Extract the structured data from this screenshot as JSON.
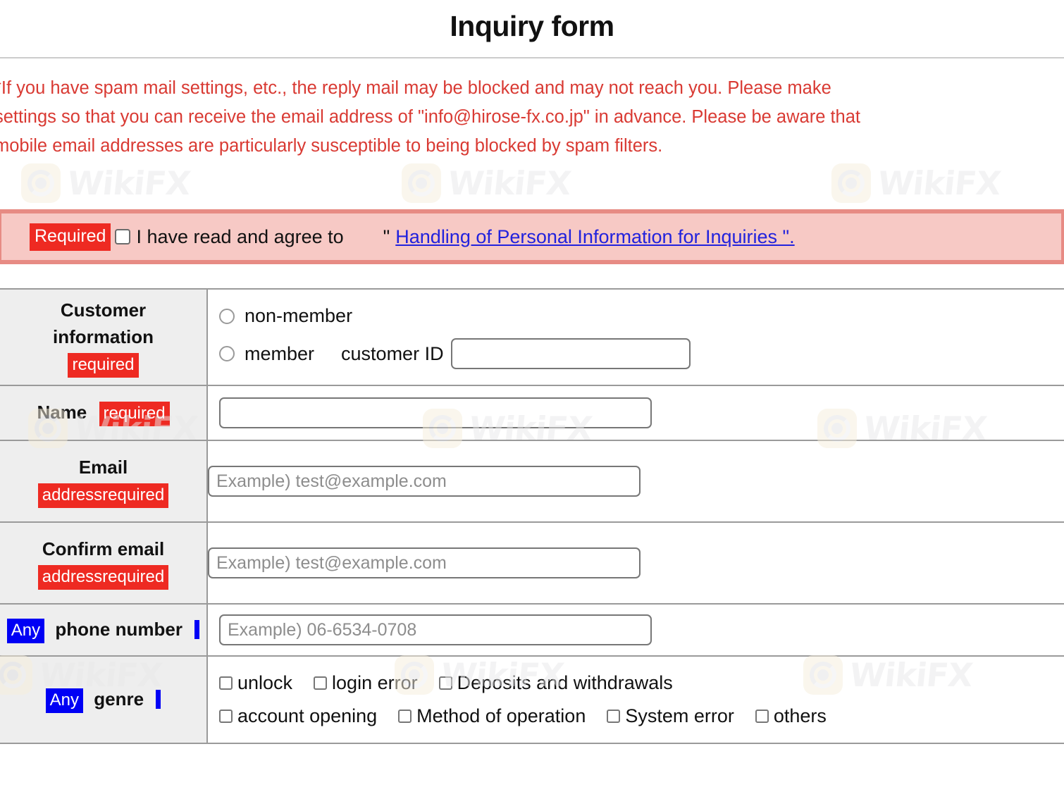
{
  "header": {
    "title": "Inquiry form"
  },
  "notice": {
    "lines": [
      "*If you have spam mail settings, etc., the reply mail may be blocked and may not reach you. Please make",
      "settings so that you can receive the email address of \"info@hirose-fx.co.jp\" in advance. Please be aware that",
      "mobile email addresses are particularly susceptible to being blocked by spam filters."
    ],
    "color": "#d93a33"
  },
  "agreement": {
    "badge": "Required",
    "text": "I have read and agree to",
    "quote_open": "\"",
    "link_text": "Handling of Personal Information for Inquiries \".",
    "checked": false,
    "badge_color": "#ee2a22",
    "box_bg": "#f7c9c5",
    "box_border": "#e78b84",
    "link_color": "#2222dd"
  },
  "form": {
    "rows": [
      {
        "label_line1": "Customer",
        "label_line2": "information",
        "badge": "required",
        "badge_kind": "required"
      },
      {
        "label_line1": "Name",
        "badge": "required",
        "badge_kind": "required"
      },
      {
        "label_line1": "Email",
        "badge": "addressrequired",
        "badge_kind": "required"
      },
      {
        "label_line1": "Confirm email",
        "badge": "addressrequired",
        "badge_kind": "required"
      },
      {
        "label_line1": "phone number",
        "badge": "Any",
        "badge_kind": "any"
      },
      {
        "label_line1": "genre",
        "badge": "Any",
        "badge_kind": "any"
      }
    ],
    "customer_information": {
      "option_nonmember": "non-member",
      "option_member": "member",
      "customer_id_label": "customer ID",
      "customer_id_value": "",
      "customer_id_placeholder": "",
      "selected": ""
    },
    "name": {
      "value": "",
      "placeholder": ""
    },
    "email": {
      "value": "",
      "placeholder": "Example) test@example.com"
    },
    "confirm_email": {
      "value": "",
      "placeholder": "Example) test@example.com"
    },
    "phone": {
      "value": "",
      "placeholder": "Example) 06-6534-0708"
    },
    "genre": {
      "row1": [
        "unlock",
        "login error",
        "Deposits and withdrawals"
      ],
      "row2": [
        "account opening",
        "Method of operation",
        "System error",
        "others"
      ]
    }
  },
  "watermark": {
    "text": "WikiFX",
    "logo": "wikifx-aperture-logo"
  }
}
